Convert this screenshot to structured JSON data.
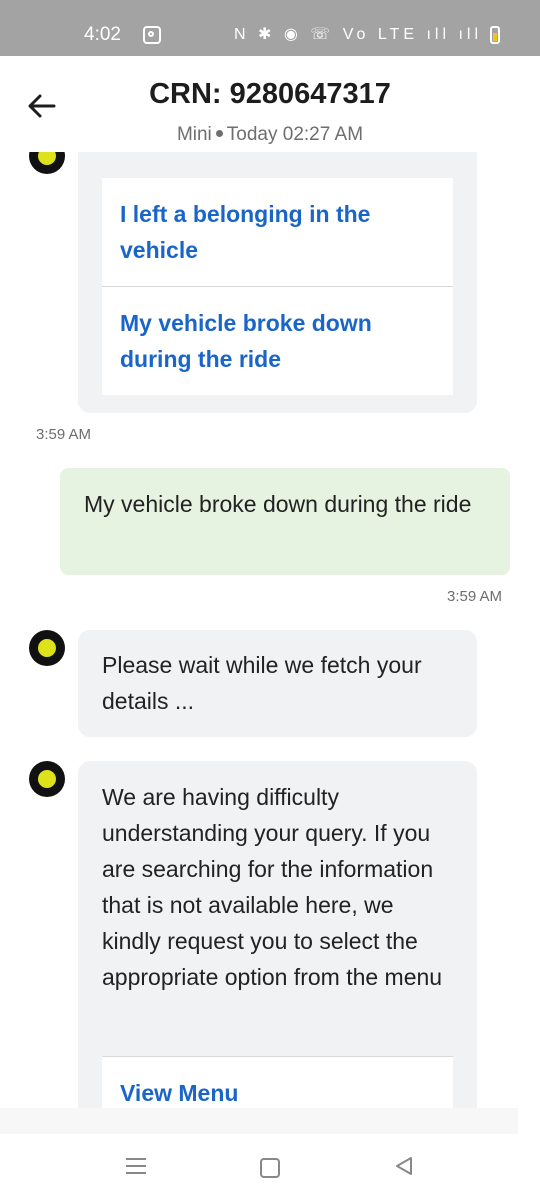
{
  "status_bar": {
    "time": "4:02",
    "icons_text": "N ✱ ◉ ☏ Vo LTE ıll ıll"
  },
  "header": {
    "title": "CRN: 9280647317",
    "vehicle": "Mini",
    "datetime": "Today 02:27 AM"
  },
  "messages": {
    "options_block": {
      "options": [
        "I left a belonging in the vehicle",
        "My vehicle broke down during the ride"
      ],
      "time": "3:59 AM"
    },
    "user_reply": {
      "text": "My vehicle broke down during the ride",
      "time": "3:59 AM"
    },
    "bot_wait": {
      "text": "Please wait while we fetch your details ..."
    },
    "bot_difficulty": {
      "text": "We are having difficulty understanding your query. If you are searching for the information that is not available here, we kindly request you to select the appropriate option from the menu",
      "button": "View Menu"
    }
  },
  "colors": {
    "link": "#1a66c8",
    "user_bubble": "#e7f3e1",
    "bot_bubble": "#f1f2f4",
    "avatar_dot": "#dde21a"
  }
}
